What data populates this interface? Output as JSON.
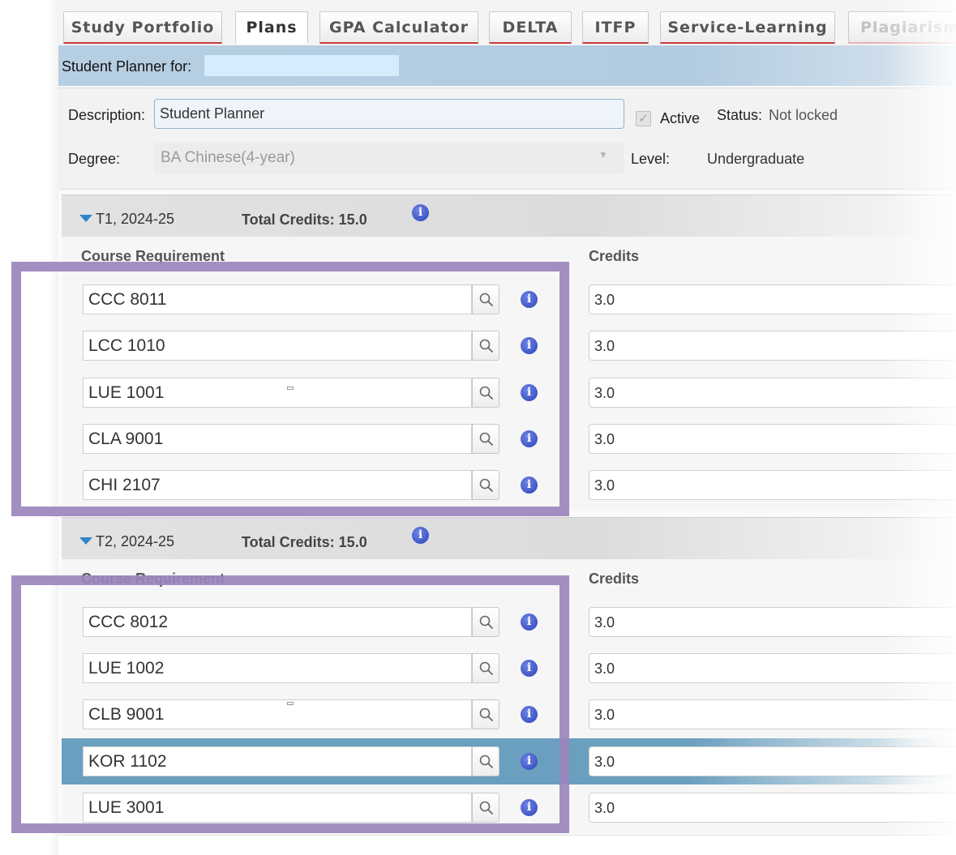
{
  "tabs": [
    {
      "label": "Study Portfolio",
      "state": "normal"
    },
    {
      "label": "Plans",
      "state": "active"
    },
    {
      "label": "GPA Calculator",
      "state": "normal"
    },
    {
      "label": "DELTA",
      "state": "normal"
    },
    {
      "label": "ITFP",
      "state": "normal"
    },
    {
      "label": "Service-Learning",
      "state": "normal"
    },
    {
      "label": "Plagiarism",
      "state": "disabled"
    }
  ],
  "student": {
    "label": "Student Planner for:",
    "name": ""
  },
  "planner": {
    "description_label": "Description:",
    "description_value": "Student Planner",
    "active_label": "Active",
    "active_checked": true,
    "status_label": "Status:",
    "status_value": "Not locked",
    "degree_label": "Degree:",
    "degree_value": "BA Chinese(4-year)",
    "level_label": "Level:",
    "level_value": "Undergraduate"
  },
  "terms": [
    {
      "title": "T1, 2024-25",
      "total_credits_label": "Total Credits: 15.0",
      "col_course": "Course Requirement",
      "col_credits": "Credits",
      "courses": [
        {
          "code": "CCC 8011",
          "credits": "3.0"
        },
        {
          "code": "LCC 1010",
          "credits": "3.0"
        },
        {
          "code": "LUE 1001",
          "credits": "3.0"
        },
        {
          "code": "CLA 9001",
          "credits": "3.0"
        },
        {
          "code": "CHI 2107",
          "credits": "3.0"
        }
      ]
    },
    {
      "title": "T2, 2024-25",
      "total_credits_label": "Total Credits: 15.0",
      "col_course": "Course Requirement",
      "col_credits": "Credits",
      "courses": [
        {
          "code": "CCC 8012",
          "credits": "3.0"
        },
        {
          "code": "LUE 1002",
          "credits": "3.0"
        },
        {
          "code": "CLB 9001",
          "credits": "3.0"
        },
        {
          "code": "KOR 1102",
          "credits": "3.0",
          "selected": true
        },
        {
          "code": "LUE 3001",
          "credits": "3.0"
        }
      ]
    }
  ],
  "colors": {
    "accent_red": "#c83a3a",
    "header_blue": "#b7cfe3",
    "selected_row": "#6b9fbf",
    "annotation_purple": "#9b84bd",
    "info_blue": "#2c43b8"
  }
}
